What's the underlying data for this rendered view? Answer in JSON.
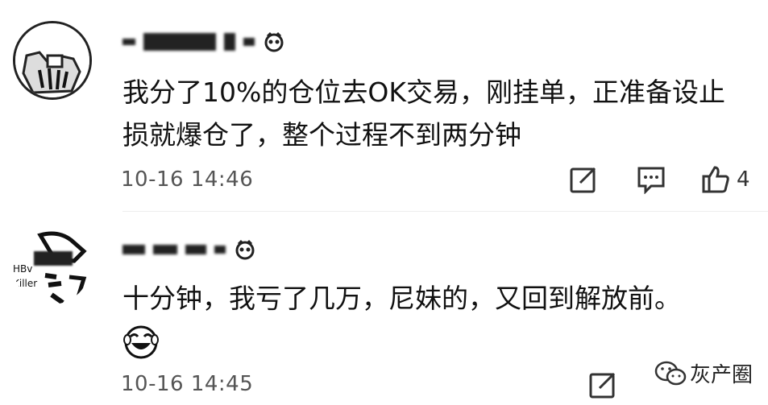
{
  "comments": [
    {
      "text": "我分了10%的仓位去OK交易，刚挂单，正准备设止损就爆仓了，整个过程不到两分钟",
      "time": "10-16 14:46",
      "like_count": "4"
    },
    {
      "avatar_text": [
        "HBv",
        "Killer"
      ],
      "text": "十分钟，我亏了几万，尼妹的，又回到解放前。",
      "time": "10-16 14:45"
    }
  ],
  "watermark": "灰产圈",
  "icons": [
    "share-icon",
    "reply-icon",
    "thumbs-up-icon",
    "laughing-emoji-icon",
    "wechat-icon"
  ]
}
